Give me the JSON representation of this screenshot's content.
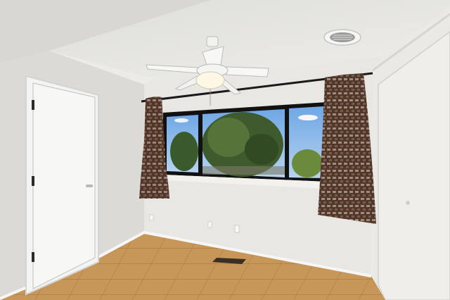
{
  "scene": {
    "kind": "photograph",
    "subject": "empty-bedroom",
    "objects": [
      {
        "name": "textured-ceiling"
      },
      {
        "name": "ceiling-fan-with-light"
      },
      {
        "name": "hvac-vent"
      },
      {
        "name": "closed-white-door"
      },
      {
        "name": "closet-sliding-door"
      },
      {
        "name": "window-with-black-frame"
      },
      {
        "name": "pine-tree-outside"
      },
      {
        "name": "patterned-curtain-left"
      },
      {
        "name": "patterned-curtain-right"
      },
      {
        "name": "curtain-rod"
      },
      {
        "name": "terracotta-tile-floor"
      },
      {
        "name": "floor-register-vent"
      },
      {
        "name": "baseboard-trim"
      },
      {
        "name": "wall-outlets"
      }
    ],
    "colors": {
      "wall": "#e6e4e0",
      "ceiling": "#e9e8e4",
      "floor_tile": "#c99a5c",
      "grout": "#b3824a",
      "window_frame": "#151515",
      "sky": "#8fb9e8",
      "tree": "#3d5a2c",
      "curtain": "#6b4a3a",
      "door": "#f3f3f1"
    }
  }
}
